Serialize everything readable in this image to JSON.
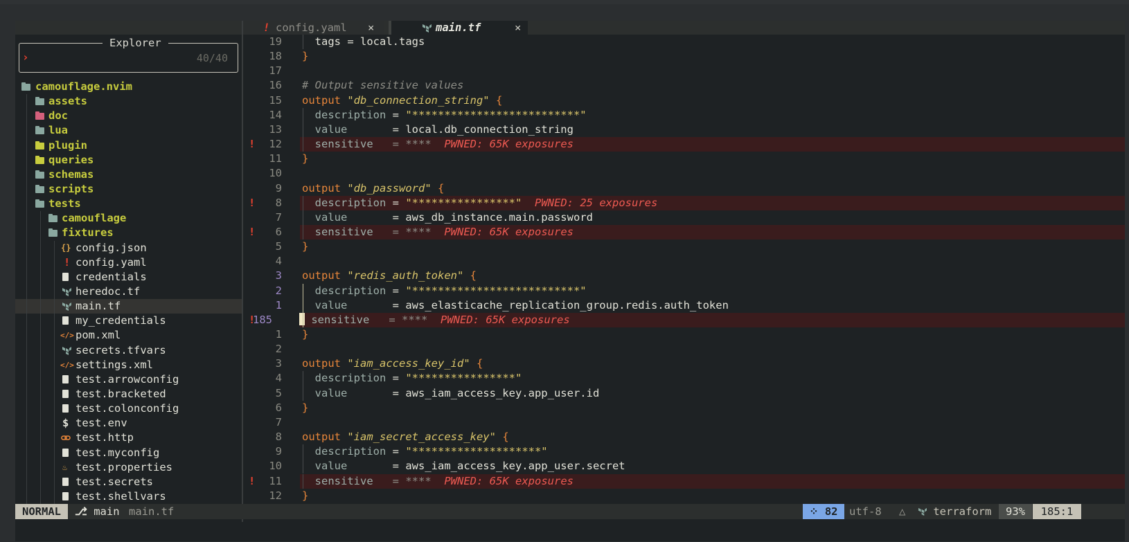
{
  "tabs": [
    {
      "icon": "!",
      "label": "config.yaml",
      "close": "×"
    },
    {
      "icon": "terraform-icon",
      "label": "main.tf",
      "close": "×"
    }
  ],
  "explorer": {
    "title": "Explorer",
    "prompt": "›",
    "count": "40/40"
  },
  "tree": {
    "root": "camouflage.nvim",
    "folders": [
      "assets",
      "doc",
      "lua",
      "plugin",
      "queries",
      "schemas",
      "scripts",
      "tests"
    ],
    "subfolders": [
      "camouflage",
      "fixtures"
    ],
    "files": [
      {
        "icon": "{}",
        "name": "config.json"
      },
      {
        "icon": "!",
        "name": "config.yaml"
      },
      {
        "icon": "file",
        "name": "credentials"
      },
      {
        "icon": "terraform",
        "name": "heredoc.tf"
      },
      {
        "icon": "terraform",
        "name": "main.tf"
      },
      {
        "icon": "file",
        "name": "my_credentials"
      },
      {
        "icon": "xml",
        "name": "pom.xml"
      },
      {
        "icon": "terraform",
        "name": "secrets.tfvars"
      },
      {
        "icon": "xml",
        "name": "settings.xml"
      },
      {
        "icon": "file",
        "name": "test.arrowconfig"
      },
      {
        "icon": "file",
        "name": "test.bracketed"
      },
      {
        "icon": "file",
        "name": "test.colonconfig"
      },
      {
        "icon": "$",
        "name": "test.env"
      },
      {
        "icon": "link",
        "name": "test.http"
      },
      {
        "icon": "file",
        "name": "test.myconfig"
      },
      {
        "icon": "java",
        "name": "test.properties"
      },
      {
        "icon": "file",
        "name": "test.secrets"
      },
      {
        "icon": "file",
        "name": "test.shellvars"
      }
    ]
  },
  "editor": {
    "lines": [
      {
        "n": "19",
        "t": [
          "tags = local.tags"
        ]
      },
      {
        "n": "18",
        "t": [
          "}"
        ]
      },
      {
        "n": "17",
        "t": [
          ""
        ]
      },
      {
        "n": "16",
        "t": [
          "# Output sensitive values"
        ]
      },
      {
        "n": "15",
        "t": [
          "output",
          "\"db_connection_string\"",
          "{"
        ]
      },
      {
        "n": "14",
        "t": [
          "description",
          "= ",
          "\"**************************\""
        ]
      },
      {
        "n": "13",
        "t": [
          "value",
          "       = local.db_connection_string"
        ]
      },
      {
        "n": "12",
        "t": [
          "sensitive",
          "   = ****",
          "PWNED: 65K exposures"
        ]
      },
      {
        "n": "11",
        "t": [
          "}"
        ]
      },
      {
        "n": "10",
        "t": [
          ""
        ]
      },
      {
        "n": "9",
        "t": [
          "output",
          "\"db_password\"",
          "{"
        ]
      },
      {
        "n": "8",
        "t": [
          "description",
          "= ",
          "\"****************\"",
          "PWNED: 25 exposures"
        ]
      },
      {
        "n": "7",
        "t": [
          "value",
          "       = aws_db_instance.main.password"
        ]
      },
      {
        "n": "6",
        "t": [
          "sensitive",
          "   = ****",
          "PWNED: 65K exposures"
        ]
      },
      {
        "n": "5",
        "t": [
          "}"
        ]
      },
      {
        "n": "4",
        "t": [
          ""
        ]
      },
      {
        "n": "3",
        "t": [
          "output",
          "\"redis_auth_token\"",
          "{"
        ]
      },
      {
        "n": "2",
        "t": [
          "description",
          "= ",
          "\"**************************\""
        ]
      },
      {
        "n": "1",
        "t": [
          "value",
          "       = aws_elasticache_replication_group.redis.auth_token"
        ]
      },
      {
        "n": "185",
        "t": [
          "sensitive",
          "   = ****",
          "PWNED: 65K exposures"
        ]
      },
      {
        "n": "1",
        "t": [
          "}"
        ]
      },
      {
        "n": "2",
        "t": [
          ""
        ]
      },
      {
        "n": "3",
        "t": [
          "output",
          "\"iam_access_key_id\"",
          "{"
        ]
      },
      {
        "n": "4",
        "t": [
          "description",
          "= ",
          "\"****************\""
        ]
      },
      {
        "n": "5",
        "t": [
          "value",
          "       = aws_iam_access_key.app_user.id"
        ]
      },
      {
        "n": "6",
        "t": [
          "}"
        ]
      },
      {
        "n": "7",
        "t": [
          ""
        ]
      },
      {
        "n": "8",
        "t": [
          "output",
          "\"iam_secret_access_key\"",
          "{"
        ]
      },
      {
        "n": "9",
        "t": [
          "description",
          "= ",
          "\"********************\""
        ]
      },
      {
        "n": "10",
        "t": [
          "value",
          "       = aws_iam_access_key.app_user.secret"
        ]
      },
      {
        "n": "11",
        "t": [
          "sensitive",
          "   = ****",
          "PWNED: 65K exposures"
        ]
      },
      {
        "n": "12",
        "t": [
          "}"
        ]
      }
    ],
    "sign_glyph": "!"
  },
  "status": {
    "mode": "NORMAL",
    "branch": "main",
    "file": "main.tf",
    "lsp": "82",
    "encoding": "utf-8",
    "filetype": "terraform",
    "percent": "93%",
    "position": "185:1"
  },
  "colors": {
    "accent": "#c8cd3e",
    "pwned": "#ee5a52",
    "keyword": "#e8863a",
    "string": "#d9c46a",
    "lsp": "#7aa6e6"
  }
}
